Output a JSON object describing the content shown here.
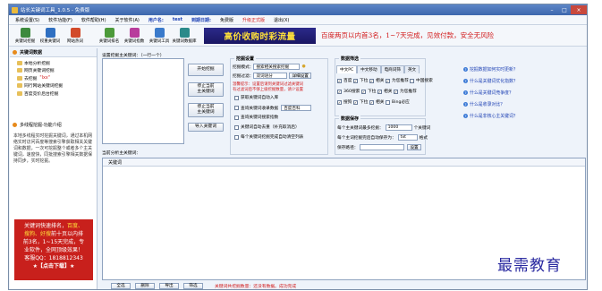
{
  "window": {
    "title": "站长关键词工具_1.0.5 - 免费版"
  },
  "menu": [
    {
      "label": "系统设置(S)",
      "style": ""
    },
    {
      "label": "软件功能(F)",
      "style": ""
    },
    {
      "label": "软件帮助(H)",
      "style": ""
    },
    {
      "label": "关于软件(A)",
      "style": ""
    },
    {
      "label": "用户名:",
      "style": "blue"
    },
    {
      "label": "test",
      "style": "blue"
    },
    {
      "label": "到期日期:",
      "style": "blue"
    },
    {
      "label": "免费版",
      "style": ""
    },
    {
      "label": "升级正式版",
      "style": "red"
    },
    {
      "label": "退出(X)",
      "style": ""
    }
  ],
  "toolbar": [
    {
      "label": "关键词挖掘",
      "icon": "pickaxe-icon",
      "color": "#3d8a3d"
    },
    {
      "label": "权重关键词",
      "icon": "weight-icon",
      "color": "#2f6fc1"
    },
    {
      "label": "网站热词",
      "icon": "fire-icon",
      "color": "#d24a2a"
    },
    {
      "label": "关键词排名",
      "icon": "ranking-icon",
      "color": "#4c9a3a"
    },
    {
      "label": "关键词指数",
      "icon": "index-chart-icon",
      "color": "#b83c9c"
    },
    {
      "label": "关键词工具",
      "icon": "wrench-icon",
      "color": "#3a7acb"
    },
    {
      "label": "关键词数据库",
      "icon": "database-icon",
      "color": "#2a8a8a"
    }
  ],
  "banner": {
    "title": "高价收购时彩流量",
    "text": "百度两页以内首3名，1~7天完成，见效付款，安全无风险"
  },
  "left": {
    "section_title": "关键词数据",
    "tree": [
      {
        "label": "本地分析挖掘"
      },
      {
        "label": "网页关键词挖掘"
      },
      {
        "label": "去挖掘",
        "extra": "\"Ixx\""
      },
      {
        "label": "同行网站关键词挖掘"
      },
      {
        "label": "百度竞价后台挖掘"
      }
    ],
    "feature_title": "多线程挖掘-功能介绍",
    "description": "本地多线程实时挖掘关键词，通过本机网络实时访问百度等搜索引擎获取相关关键词和数据，一次可挖掘整个或者多个主关键词，速度快，同批搜索引擎相关数据保持同步，实时挖掘。",
    "ad": {
      "line1a": "关键词快速排名，",
      "line1b": "百度、",
      "line2a": "搜狗、",
      "line2b": "好搜",
      "line2c": "前十页以内排",
      "line3": "前3名，1~15天完成，专",
      "line4": "业软件，全网顶级效果！",
      "line5": "客服QQ：1818812343",
      "button": "★【点击下载】★"
    }
  },
  "center": {
    "input_label": "设置挖掘主关键词：（一行一个）",
    "result_label": "当前分析主关键词：",
    "table_header": "关键词",
    "buttons": {
      "start": "开始挖掘",
      "stop_current": "停止当前\n主关键词",
      "stop_current_main": "停止当前\n主关键词",
      "import": "导入关键词"
    }
  },
  "settings": {
    "title": "挖掘设置",
    "mode_label": "挖掘模式：",
    "mode_value": "搜索相关搜索挖掘",
    "filter_label": "挖掘过滤：",
    "filter_value": "双词语分",
    "filter_button": "详细设置",
    "note": "温馨提示：设置后请到关键词过滤关键词",
    "note2": "有过滤词后不够上级挖掘数量，请少设置",
    "options": [
      {
        "label": "获取关键词自动入库",
        "checked": false
      },
      {
        "label": "查询关键词收录数据",
        "checked": false,
        "select": "百度百科"
      },
      {
        "label": "查询关键词搜索指数",
        "checked": false
      },
      {
        "label": "关键词自动去重（补充取消后）",
        "checked": false
      },
      {
        "label": "每个关键词挖掘完成自动清空列表",
        "checked": false
      }
    ]
  },
  "data_settings": {
    "title": "数据筛选",
    "tabs": [
      "中文PC",
      "中文移动",
      "电商词筛",
      "英文"
    ],
    "checks": [
      {
        "label": "百度",
        "checked": true
      },
      {
        "label": "下拉",
        "checked": true
      },
      {
        "label": "相关",
        "checked": true
      },
      {
        "label": "为您推荐",
        "checked": true
      },
      {
        "label": "中国搜索",
        "checked": false
      },
      {
        "label": "360搜索",
        "checked": true
      },
      {
        "label": "下拉",
        "checked": true
      },
      {
        "label": "相关",
        "checked": true
      },
      {
        "label": "为您推荐",
        "checked": true
      },
      {
        "label": "搜狗",
        "checked": true
      },
      {
        "label": "下拉",
        "checked": true
      },
      {
        "label": "相关",
        "checked": true
      },
      {
        "label": "Bing必应",
        "checked": false
      }
    ]
  },
  "save_settings": {
    "title": "数据保存",
    "max_label": "每个主关键词最多挖掘：",
    "max_value": "1000",
    "max_unit": "个关键词",
    "format_label": "每个主词挖掘完后自动保存为：",
    "format_value": "txt",
    "format_unit": "格式",
    "path_label": "保存路径：",
    "path_button": "设置"
  },
  "help_links": [
    "挖掘数据如何实时更新？",
    "什么是关键词优化指数？",
    "什么是关键词竞争度？",
    "什么是收录对比？",
    "什么是非核心主关键词？"
  ],
  "status": {
    "buttons": [
      "全选",
      "删除",
      "导出",
      "筛选"
    ],
    "text": "关键词共挖掘数量：还没有数据。成功完成"
  },
  "watermark": "最需教育"
}
